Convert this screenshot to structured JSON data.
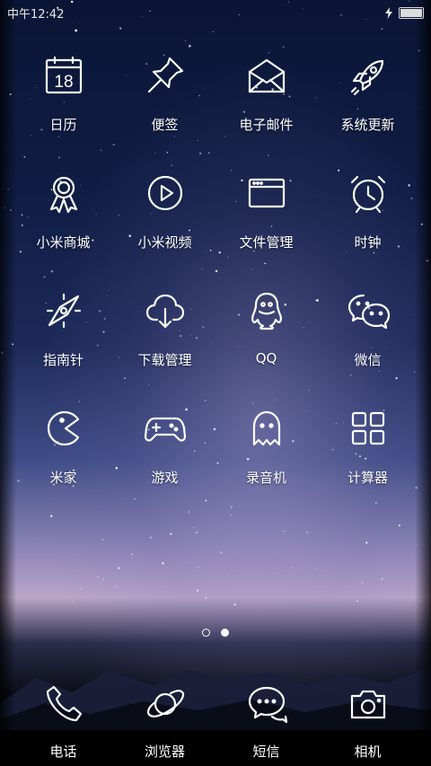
{
  "status": {
    "time": "中午12:42",
    "battery_level": 0.92
  },
  "apps": [
    {
      "label": "日历",
      "icon": "calendar-icon",
      "day": "18"
    },
    {
      "label": "便签",
      "icon": "pin-icon"
    },
    {
      "label": "电子邮件",
      "icon": "mail-icon"
    },
    {
      "label": "系统更新",
      "icon": "rocket-icon"
    },
    {
      "label": "小米商城",
      "icon": "award-ribbon-icon"
    },
    {
      "label": "小米视频",
      "icon": "play-icon"
    },
    {
      "label": "文件管理",
      "icon": "folder-window-icon"
    },
    {
      "label": "时钟",
      "icon": "alarm-clock-icon"
    },
    {
      "label": "指南针",
      "icon": "compass-icon"
    },
    {
      "label": "下载管理",
      "icon": "cloud-download-icon"
    },
    {
      "label": "QQ",
      "icon": "qq-penguin-icon"
    },
    {
      "label": "微信",
      "icon": "wechat-icon"
    },
    {
      "label": "米家",
      "icon": "pacman-icon"
    },
    {
      "label": "游戏",
      "icon": "gamepad-icon"
    },
    {
      "label": "录音机",
      "icon": "ghost-icon"
    },
    {
      "label": "计算器",
      "icon": "grid-squares-icon"
    }
  ],
  "pager": {
    "count": 2,
    "active": 2
  },
  "dock": [
    {
      "label": "电话",
      "icon": "phone-icon"
    },
    {
      "label": "浏览器",
      "icon": "planet-icon"
    },
    {
      "label": "短信",
      "icon": "chat-bubbles-icon"
    },
    {
      "label": "相机",
      "icon": "camera-icon"
    }
  ]
}
